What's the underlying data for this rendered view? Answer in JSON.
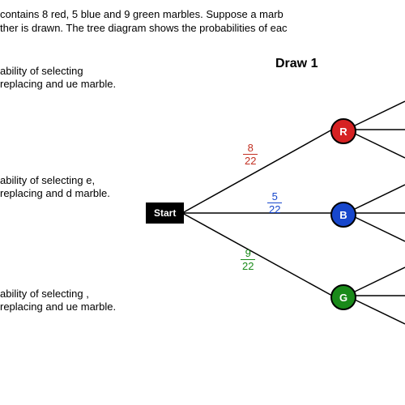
{
  "intro": {
    "line1": "contains 8 red, 5 blue and 9 green marbles.  Suppose a marb",
    "line2": "ther is drawn.  The tree diagram shows the probabilities of eac"
  },
  "questions": {
    "a": "ability of selecting replacing and ue marble.",
    "b": "ability of selecting e, replacing and d marble.",
    "c": "ability of selecting , replacing and ue marble."
  },
  "heading": "Draw 1",
  "start": "Start",
  "nodes": {
    "r": "R",
    "b": "B",
    "g": "G"
  },
  "probs": {
    "r": {
      "num": "8",
      "den": "22"
    },
    "b": {
      "num": "5",
      "den": "22"
    },
    "g": {
      "num": "9",
      "den": "22"
    }
  },
  "chart_data": {
    "type": "tree",
    "title": "Draw 1",
    "root": "Start",
    "branches": [
      {
        "label": "R",
        "color": "red",
        "probability": "8/22"
      },
      {
        "label": "B",
        "color": "blue",
        "probability": "5/22"
      },
      {
        "label": "G",
        "color": "green",
        "probability": "9/22"
      }
    ],
    "total_marbles": 22,
    "counts": {
      "red": 8,
      "blue": 5,
      "green": 9
    }
  }
}
